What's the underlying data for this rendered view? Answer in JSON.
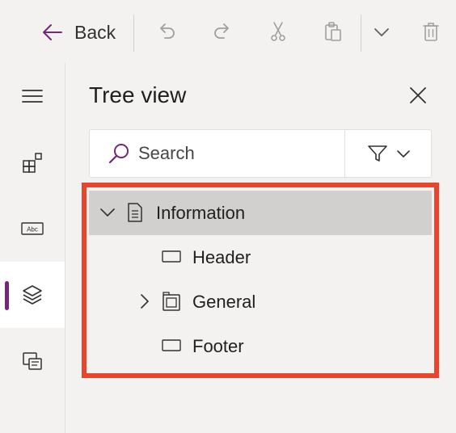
{
  "toolbar": {
    "back_label": "Back",
    "buttons": [
      {
        "icon": "undo-icon"
      },
      {
        "icon": "redo-icon"
      },
      {
        "icon": "cut-icon"
      },
      {
        "icon": "paste-icon"
      },
      {
        "icon": "chevron-down-icon"
      },
      {
        "icon": "delete-icon"
      }
    ]
  },
  "rail": {
    "items": [
      {
        "icon": "hamburger-menu-icon"
      },
      {
        "icon": "insert-icon"
      },
      {
        "icon": "data-icon"
      },
      {
        "icon": "tree-view-layers-icon",
        "active": true
      },
      {
        "icon": "screens-icon"
      }
    ]
  },
  "panel": {
    "title": "Tree view",
    "search": {
      "placeholder": "Search",
      "value": ""
    },
    "tree": [
      {
        "label": "Information",
        "icon": "screen-icon",
        "expanded": true,
        "selected": true,
        "level": 0
      },
      {
        "label": "Header",
        "icon": "rectangle-icon",
        "level": 1
      },
      {
        "label": "General",
        "icon": "container-icon",
        "expanded": false,
        "level": 1,
        "has_children": true
      },
      {
        "label": "Footer",
        "icon": "rectangle-icon",
        "level": 1
      }
    ]
  },
  "colors": {
    "accent": "#742774",
    "highlight_frame": "#e8452c",
    "selected_row": "#d2d0ce",
    "background": "#f3f2f1"
  }
}
